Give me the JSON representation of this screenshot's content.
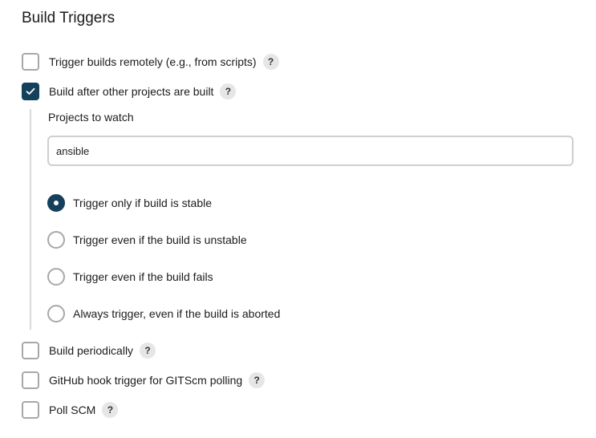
{
  "section": {
    "title": "Build Triggers"
  },
  "colors": {
    "accent": "#14405c",
    "border": "#a8a8a8",
    "help_bg": "#e6e6e6"
  },
  "triggers": [
    {
      "label": "Trigger builds remotely (e.g., from scripts)",
      "checked": false,
      "help": "?"
    },
    {
      "label": "Build after other projects are built",
      "checked": true,
      "help": "?"
    },
    {
      "label": "Build periodically",
      "checked": false,
      "help": "?"
    },
    {
      "label": "GitHub hook trigger for GITScm polling",
      "checked": false,
      "help": "?"
    },
    {
      "label": "Poll SCM",
      "checked": false,
      "help": "?"
    }
  ],
  "build_after": {
    "projects_label": "Projects to watch",
    "projects_value": "ansible",
    "options": [
      {
        "label": "Trigger only if build is stable",
        "selected": true
      },
      {
        "label": "Trigger even if the build is unstable",
        "selected": false
      },
      {
        "label": "Trigger even if the build fails",
        "selected": false
      },
      {
        "label": "Always trigger, even if the build is aborted",
        "selected": false
      }
    ]
  }
}
